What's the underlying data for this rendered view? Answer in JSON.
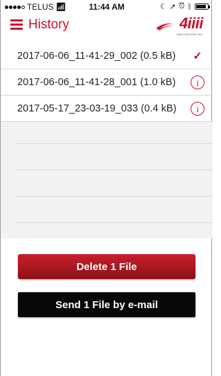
{
  "status_bar": {
    "carrier": "TELUS",
    "time": "11:44 AM",
    "signal_icon": "signal-dots-icon",
    "wifi_icon": "wifi-icon",
    "battery_icon": "battery-icon",
    "battery_level": 0.85
  },
  "nav": {
    "title": "History",
    "menu_icon": "hamburger-menu-icon",
    "brand_name": "4iiii",
    "brand_tagline": "INNOVATIONS INC."
  },
  "files": [
    {
      "name": "2017-06-06_11-41-29_002 (0.5 kB)",
      "status_icon": "checkmark-icon"
    },
    {
      "name": "2017-06-06_11-41-28_001 (1.0 kB)",
      "status_icon": "info-icon"
    },
    {
      "name": "2017-05-17_23-03-19_033 (0.4 kB)",
      "status_icon": "info-icon"
    }
  ],
  "actions": {
    "delete_label": "Delete 1 File",
    "send_label": "Send 1 File by e-mail"
  },
  "colors": {
    "accent": "#c8102e",
    "send_button": "#080808"
  }
}
